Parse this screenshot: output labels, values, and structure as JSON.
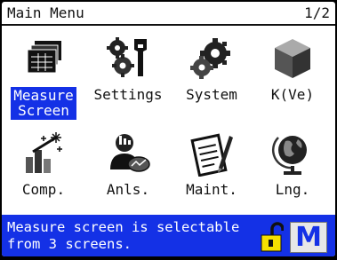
{
  "header": {
    "title": "Main Menu",
    "page": "1/2"
  },
  "menu": [
    {
      "label": "Measure\nScreen",
      "selected": true
    },
    {
      "label": "Settings"
    },
    {
      "label": "System"
    },
    {
      "label": "K(Ve)"
    },
    {
      "label": "Comp."
    },
    {
      "label": "Anls."
    },
    {
      "label": "Maint."
    },
    {
      "label": "Lng."
    }
  ],
  "status": {
    "message": "Measure screen is selectable from 3 screens.",
    "mode_letter": "M"
  },
  "colors": {
    "selection": "#1431e6",
    "lock": "#f5e000"
  }
}
